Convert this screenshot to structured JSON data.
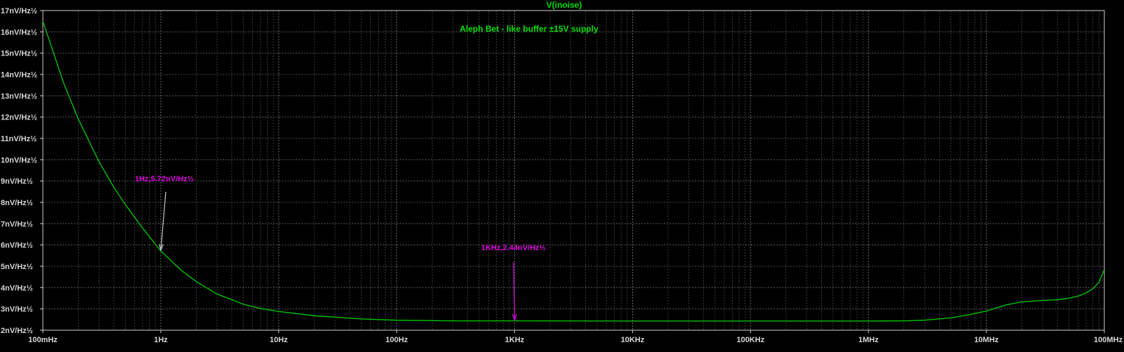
{
  "chart_data": {
    "type": "line",
    "title": "V(inoise)",
    "subtitle": "Aleph Bet - like buffer ±15V supply",
    "x_scale": "log",
    "xlim": [
      0.1,
      100000000
    ],
    "ylim": [
      2,
      17
    ],
    "grid": true,
    "x_ticks": [
      {
        "value": 0.1,
        "label": "100mHz"
      },
      {
        "value": 1,
        "label": "1Hz"
      },
      {
        "value": 10,
        "label": "10Hz"
      },
      {
        "value": 100,
        "label": "100Hz"
      },
      {
        "value": 1000,
        "label": "1KHz"
      },
      {
        "value": 10000,
        "label": "10KHz"
      },
      {
        "value": 100000,
        "label": "100KHz"
      },
      {
        "value": 1000000,
        "label": "1MHz"
      },
      {
        "value": 10000000,
        "label": "10MHz"
      },
      {
        "value": 100000000,
        "label": "100MHz"
      }
    ],
    "y_ticks": [
      {
        "value": 17,
        "label": "17nV/Hz½"
      },
      {
        "value": 16,
        "label": "16nV/Hz½"
      },
      {
        "value": 15,
        "label": "15nV/Hz½"
      },
      {
        "value": 14,
        "label": "14nV/Hz½"
      },
      {
        "value": 13,
        "label": "13nV/Hz½"
      },
      {
        "value": 12,
        "label": "12nV/Hz½"
      },
      {
        "value": 11,
        "label": "11nV/Hz½"
      },
      {
        "value": 10,
        "label": "10nV/Hz½"
      },
      {
        "value": 9,
        "label": "9nV/Hz½"
      },
      {
        "value": 8,
        "label": "8nV/Hz½"
      },
      {
        "value": 7,
        "label": "7nV/Hz½"
      },
      {
        "value": 6,
        "label": "6nV/Hz½"
      },
      {
        "value": 5,
        "label": "5nV/Hz½"
      },
      {
        "value": 4,
        "label": "4nV/Hz½"
      },
      {
        "value": 3,
        "label": "3nV/Hz½"
      },
      {
        "value": 2,
        "label": "2nV/Hz½"
      }
    ],
    "series": [
      {
        "name": "V(inoise)",
        "color": "#00c000",
        "x": [
          0.1,
          0.15,
          0.2,
          0.3,
          0.4,
          0.5,
          0.7,
          1,
          1.5,
          2,
          3,
          5,
          7,
          10,
          20,
          50,
          100,
          300,
          1000,
          10000,
          100000,
          1000000,
          2000000,
          3000000,
          5000000,
          7000000,
          10000000,
          15000000,
          20000000,
          30000000,
          40000000,
          50000000,
          60000000,
          70000000,
          80000000,
          90000000,
          100000000
        ],
        "y": [
          16.5,
          13.6,
          11.9,
          9.9,
          8.7,
          7.9,
          6.8,
          5.72,
          4.8,
          4.28,
          3.7,
          3.22,
          3.02,
          2.88,
          2.68,
          2.53,
          2.47,
          2.44,
          2.44,
          2.43,
          2.43,
          2.43,
          2.44,
          2.47,
          2.58,
          2.72,
          2.9,
          3.2,
          3.33,
          3.4,
          3.43,
          3.5,
          3.6,
          3.75,
          3.95,
          4.25,
          4.85
        ]
      }
    ],
    "annotations": [
      {
        "text": "1Hz,5.72nV/Hz½",
        "x": 1,
        "y": 5.72,
        "color": "#e000e0",
        "arrow_color": "#c8c8c8"
      },
      {
        "text": "1KHz,2.44nV/Hz½",
        "x": 1000,
        "y": 2.44,
        "color": "#e000e0",
        "arrow_color": "#e000e0"
      }
    ]
  },
  "colors": {
    "background": "#000000",
    "frame": "#d0d0d0",
    "grid": "#8a8a8a",
    "title": "#00e000",
    "subtitle": "#00e000"
  }
}
